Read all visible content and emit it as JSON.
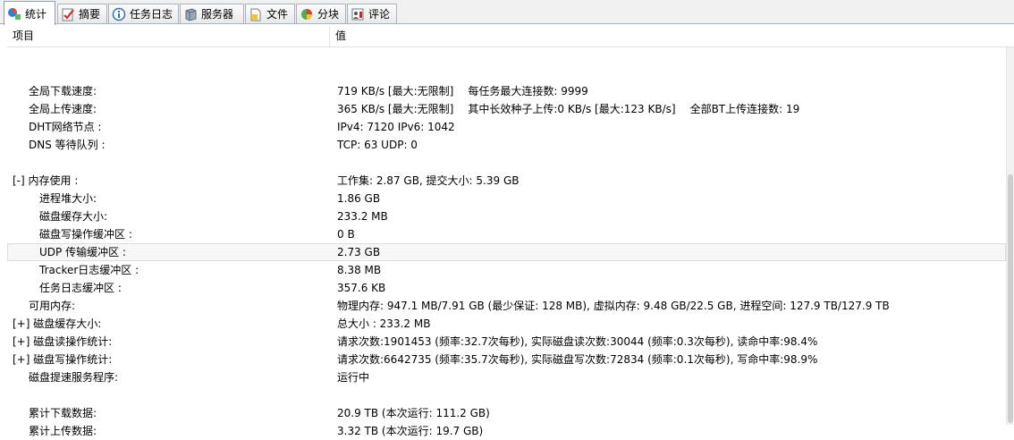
{
  "tabs": [
    {
      "label": "统计",
      "icon": "stats-icon",
      "active": true
    },
    {
      "label": "摘要",
      "icon": "summary-icon",
      "active": false
    },
    {
      "label": "任务日志",
      "icon": "info-icon",
      "active": false
    },
    {
      "label": "服务器",
      "icon": "server-icon",
      "active": false
    },
    {
      "label": "文件",
      "icon": "file-icon",
      "active": false
    },
    {
      "label": "分块",
      "icon": "pie-icon",
      "active": false
    },
    {
      "label": "评论",
      "icon": "comment-icon",
      "active": false
    }
  ],
  "columns": {
    "item": "项目",
    "value": "值"
  },
  "rows": [
    {
      "key": "",
      "values": [],
      "indent": 0
    },
    {
      "key": "全局下载速度:",
      "values": [
        "719 KB/s [最大:无限制]",
        "每任务最大连接数: 9999"
      ],
      "indent": 1
    },
    {
      "key": "全局上传速度:",
      "values": [
        "365 KB/s [最大:无限制]",
        "其中长效种子上传:0 KB/s [最大:123 KB/s]",
        "全部BT上传连接数: 19"
      ],
      "indent": 1
    },
    {
      "key": "DHT网络节点 :",
      "values": [
        "IPv4: 7120  IPv6: 1042"
      ],
      "indent": 1
    },
    {
      "key": "DNS 等待队列 :",
      "values": [
        "TCP: 63  UDP: 0"
      ],
      "indent": 1
    },
    {
      "key": "",
      "values": [],
      "indent": 0
    },
    {
      "key": "[-] 内存使用 :",
      "values": [
        "工作集: 2.87 GB, 提交大小: 5.39 GB"
      ],
      "indent": 0
    },
    {
      "key": "进程堆大小:",
      "values": [
        "1.86 GB"
      ],
      "indent": 2
    },
    {
      "key": "磁盘缓存大小:",
      "values": [
        "233.2 MB"
      ],
      "indent": 2
    },
    {
      "key": "磁盘写操作缓冲区 :",
      "values": [
        "0 B"
      ],
      "indent": 2
    },
    {
      "key": "UDP 传输缓冲区 :",
      "values": [
        "2.73 GB"
      ],
      "indent": 2,
      "selected": true
    },
    {
      "key": "Tracker日志缓冲区 :",
      "values": [
        "8.38 MB"
      ],
      "indent": 2
    },
    {
      "key": "任务日志缓冲区 :",
      "values": [
        "357.6 KB"
      ],
      "indent": 2
    },
    {
      "key": "可用内存:",
      "values": [
        "物理内存: 947.1 MB/7.91 GB (最少保证: 128 MB), 虚拟内存: 9.48 GB/22.5 GB, 进程空间: 127.9 TB/127.9 TB"
      ],
      "indent": 1
    },
    {
      "key": "[+] 磁盘缓存大小:",
      "values": [
        "总大小 : 233.2 MB"
      ],
      "indent": 0
    },
    {
      "key": "[+] 磁盘读操作统计:",
      "values": [
        "请求次数:1901453 (频率:32.7次每秒), 实际磁盘读次数:30044 (频率:0.3次每秒), 读命中率:98.4%"
      ],
      "indent": 0
    },
    {
      "key": "[+] 磁盘写操作统计:",
      "values": [
        "请求次数:6642735 (频率:35.7次每秒), 实际磁盘写次数:72834 (频率:0.1次每秒), 写命中率:98.9%"
      ],
      "indent": 0
    },
    {
      "key": "磁盘提速服务程序:",
      "values": [
        "运行中"
      ],
      "indent": 1
    },
    {
      "key": "",
      "values": [],
      "indent": 0
    },
    {
      "key": "累计下载数据:",
      "values": [
        "20.9 TB (本次运行: 111.2 GB)"
      ],
      "indent": 1
    },
    {
      "key": "累计上传数据:",
      "values": [
        "3.32 TB (本次运行: 19.7 GB)"
      ],
      "indent": 1
    }
  ]
}
